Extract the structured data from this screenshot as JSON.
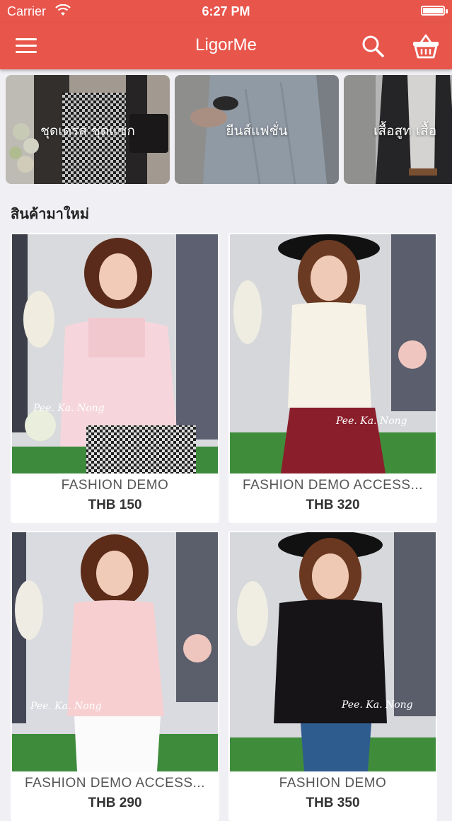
{
  "status_bar": {
    "carrier": "Carrier",
    "time": "6:27 PM"
  },
  "nav": {
    "title": "LigorMe",
    "icons": [
      "menu-icon",
      "search-icon",
      "basket-icon"
    ]
  },
  "categories": [
    {
      "label": "ชุดเดรส ชุดแซก"
    },
    {
      "label": "ยีนส์แฟชั่น"
    },
    {
      "label": "เสื้อสูท เสื้อ"
    }
  ],
  "section": {
    "title": "สินค้ามาใหม่"
  },
  "products": [
    {
      "name": "FASHION DEMO",
      "price": "THB 150"
    },
    {
      "name": "FASHION DEMO ACCESS...",
      "price": "THB 320"
    },
    {
      "name": "FASHION DEMO ACCESS...",
      "price": "THB 290"
    },
    {
      "name": "FASHION DEMO",
      "price": "THB 350"
    }
  ],
  "watermark": "Pee. Ka. Nong",
  "colors": {
    "brand": "#e8554b",
    "background": "#efeff4"
  }
}
